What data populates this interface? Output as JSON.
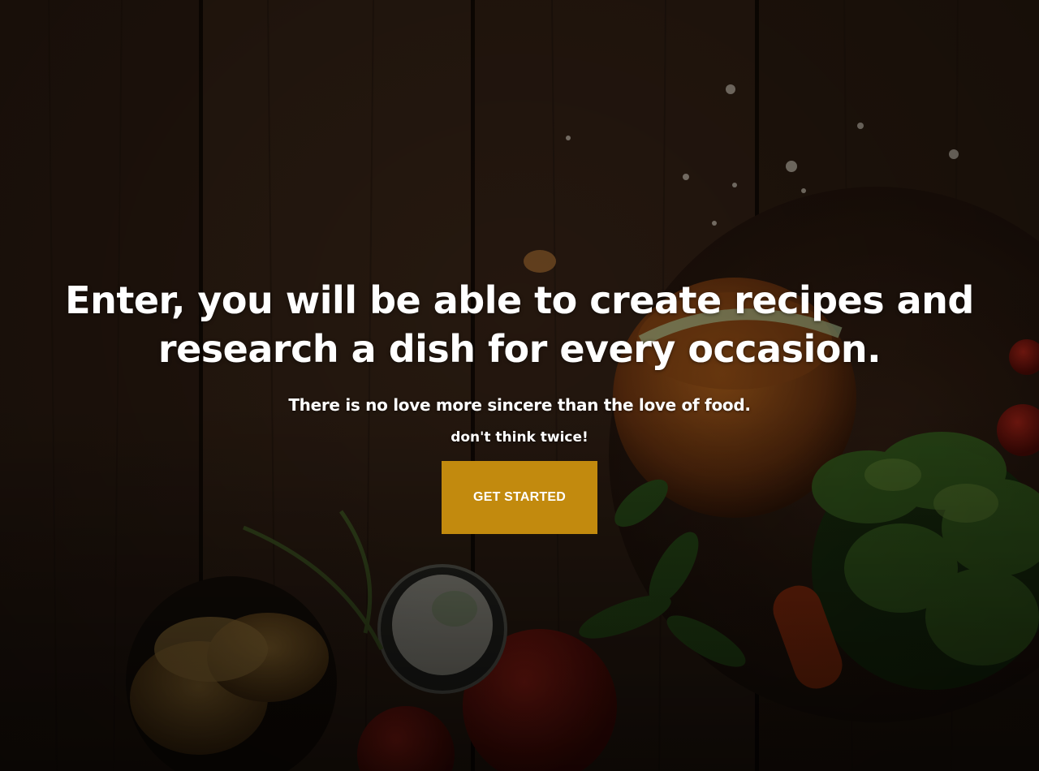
{
  "hero": {
    "headline": "Enter, you will be able to create recipes and research a dish for every occasion.",
    "subline": "There is no love more sincere than the love of food.",
    "tagline": "don't think twice!",
    "cta_label": "GET STARTED"
  },
  "colors": {
    "cta_background": "#c28a0e",
    "text": "#ffffff",
    "wood": "#3b2616"
  },
  "background": {
    "icon": "food-table-background-image"
  }
}
